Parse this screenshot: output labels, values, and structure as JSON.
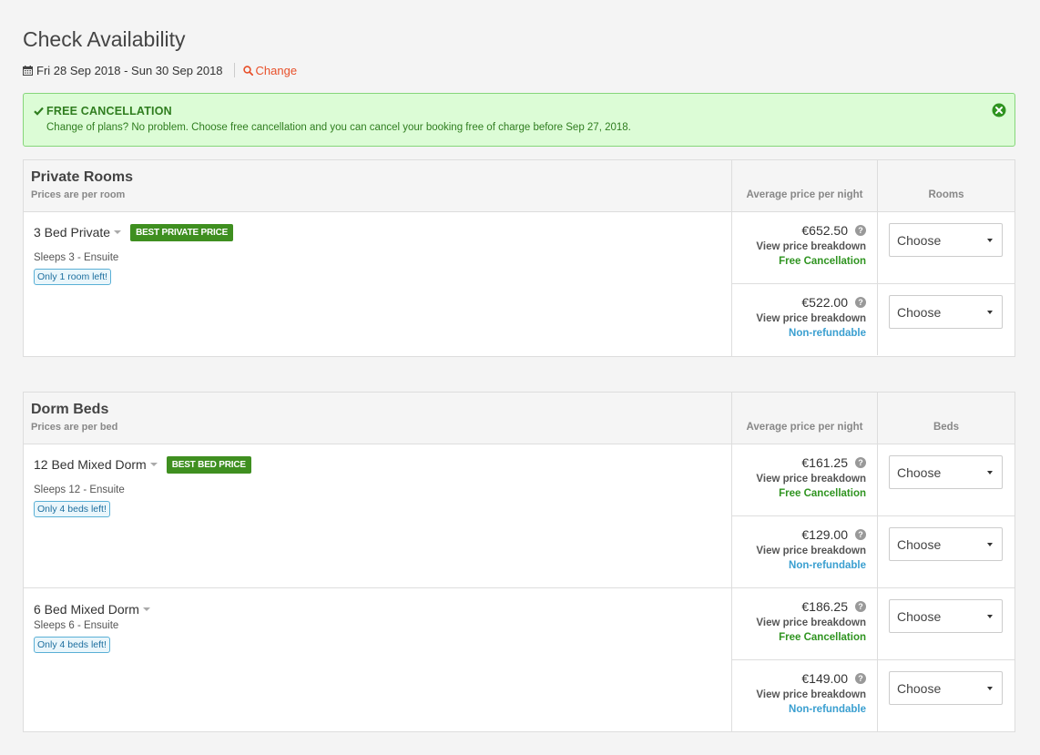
{
  "header": {
    "title": "Check Availability",
    "dates": "Fri 28 Sep 2018 - Sun 30 Sep 2018",
    "change_label": "Change"
  },
  "alert": {
    "title": "FREE CANCELLATION",
    "body": "Change of plans? No problem. Choose free cancellation and you can cancel your booking free of charge before Sep 27, 2018."
  },
  "private": {
    "heading": "Private Rooms",
    "subheading": "Prices are per room",
    "price_col": "Average price per night",
    "qty_col": "Rooms",
    "rooms": [
      {
        "name": "3 Bed Private",
        "badge": "BEST PRIVATE PRICE",
        "sleeps": "Sleeps 3 - Ensuite",
        "availability": "Only 1 room left!",
        "rates": [
          {
            "price": "€652.50",
            "breakdown": "View price breakdown",
            "condition": "Free Cancellation",
            "select": "Choose"
          },
          {
            "price": "€522.00",
            "breakdown": "View price breakdown",
            "condition": "Non-refundable",
            "select": "Choose"
          }
        ]
      }
    ]
  },
  "dorm": {
    "heading": "Dorm Beds",
    "subheading": "Prices are per bed",
    "price_col": "Average price per night",
    "qty_col": "Beds",
    "rooms": [
      {
        "name": "12 Bed Mixed Dorm",
        "badge": "BEST BED PRICE",
        "sleeps": "Sleeps 12 - Ensuite",
        "availability": "Only 4 beds left!",
        "rates": [
          {
            "price": "€161.25",
            "breakdown": "View price breakdown",
            "condition": "Free Cancellation",
            "select": "Choose"
          },
          {
            "price": "€129.00",
            "breakdown": "View price breakdown",
            "condition": "Non-refundable",
            "select": "Choose"
          }
        ]
      },
      {
        "name": "6 Bed Mixed Dorm",
        "sleeps": "Sleeps 6 - Ensuite",
        "availability": "Only 4 beds left!",
        "rates": [
          {
            "price": "€186.25",
            "breakdown": "View price breakdown",
            "condition": "Free Cancellation",
            "select": "Choose"
          },
          {
            "price": "€149.00",
            "breakdown": "View price breakdown",
            "condition": "Non-refundable",
            "select": "Choose"
          }
        ]
      }
    ]
  },
  "icons": {
    "calendar": "calendar-icon",
    "search": "search-icon",
    "check": "check-icon",
    "close": "close-circle-icon",
    "help": "question-icon"
  },
  "colors": {
    "accent": "#e8502a",
    "success": "#2f9420",
    "badge": "#3f8f20",
    "info": "#3a9fd0"
  }
}
